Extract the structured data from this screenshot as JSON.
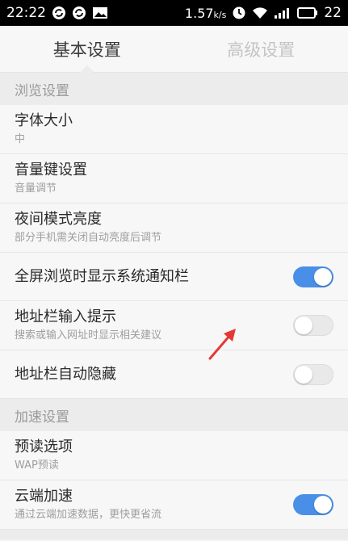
{
  "status_bar": {
    "time": "22:22",
    "battery_percent": "1.57",
    "battery_unit": "k/s",
    "signal_text": "22",
    "left_icons": [
      "sync-icon",
      "sync-icon",
      "image-icon"
    ],
    "right_icons": [
      "alarm-icon",
      "wifi-icon",
      "signal-icon",
      "battery-icon"
    ]
  },
  "tabs": [
    {
      "label": "基本设置",
      "active": true
    },
    {
      "label": "高级设置",
      "active": false
    }
  ],
  "sections": {
    "browse": "浏览设置",
    "accelerate": "加速设置"
  },
  "rows": {
    "font_size": {
      "title": "字体大小",
      "sub": "中"
    },
    "volume_key": {
      "title": "音量键设置",
      "sub": "音量调节"
    },
    "night_brightness": {
      "title": "夜间模式亮度",
      "sub": "部分手机需关闭自动亮度后调节"
    },
    "fullscreen_notify": {
      "title": "全屏浏览时显示系统通知栏",
      "toggle": true
    },
    "address_hint": {
      "title": "地址栏输入提示",
      "sub": "搜索或输入网址时显示相关建议",
      "toggle": false
    },
    "address_autohide": {
      "title": "地址栏自动隐藏",
      "toggle": false
    },
    "preread": {
      "title": "预读选项",
      "sub": "WAP预读"
    },
    "cloud_accel": {
      "title": "云端加速",
      "sub": "通过云端加速数据，更快更省流",
      "toggle": true
    }
  },
  "colors": {
    "accent": "#4a8fe7",
    "arrow": "#e53935"
  }
}
